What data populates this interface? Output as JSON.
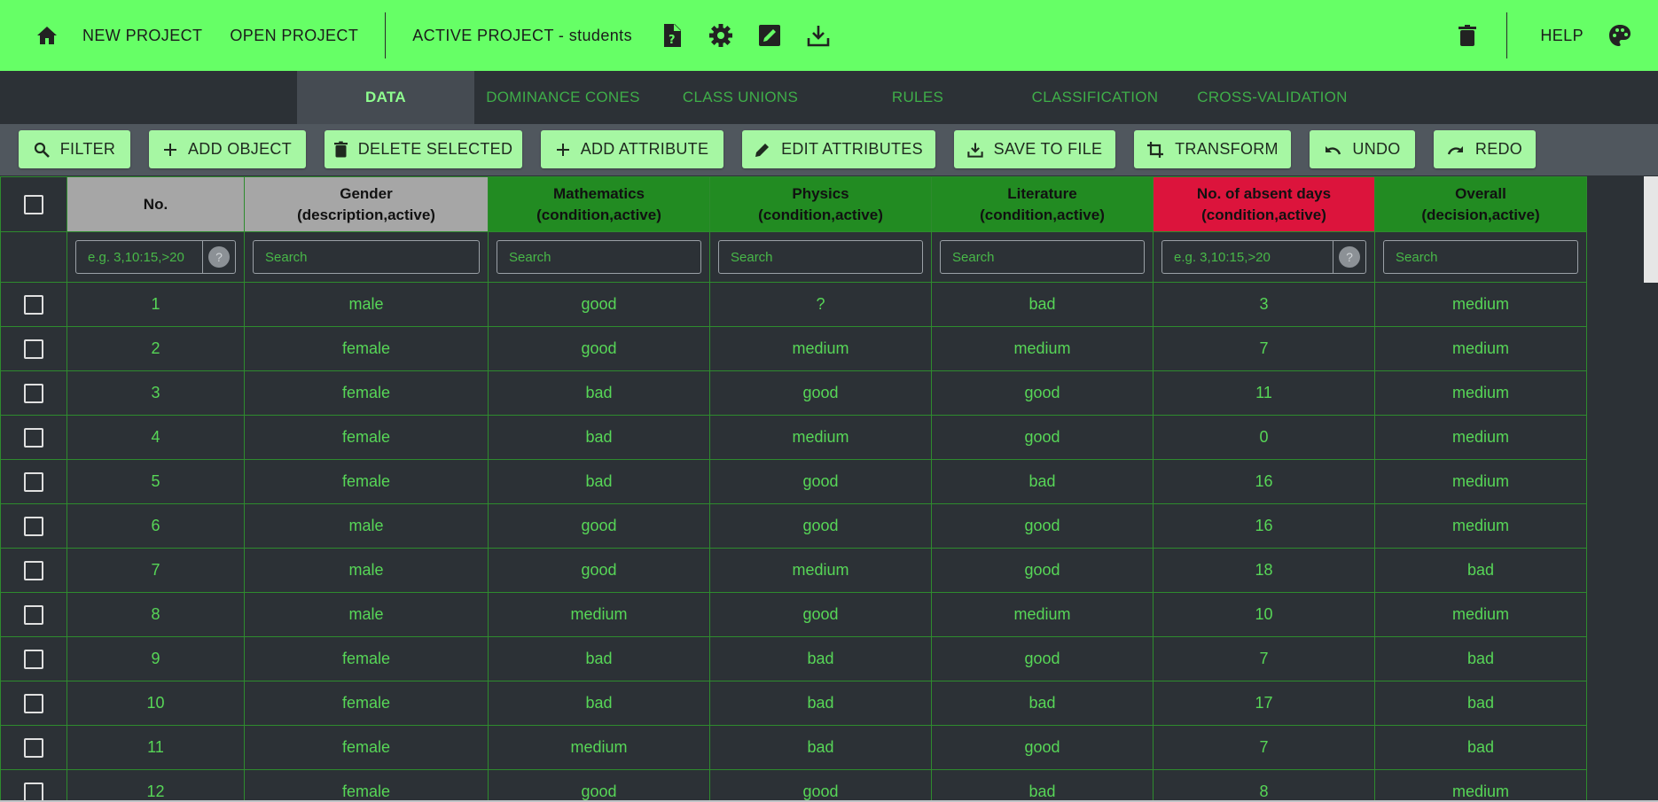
{
  "appbar": {
    "new_project": "NEW PROJECT",
    "open_project": "OPEN PROJECT",
    "active_project": "ACTIVE PROJECT - students",
    "help": "HELP"
  },
  "tabs": [
    {
      "label": "DATA",
      "active": true
    },
    {
      "label": "DOMINANCE CONES"
    },
    {
      "label": "CLASS UNIONS"
    },
    {
      "label": "RULES"
    },
    {
      "label": "CLASSIFICATION"
    },
    {
      "label": "CROSS-VALIDATION"
    }
  ],
  "toolbar": {
    "filter": "FILTER",
    "add_object": "ADD OBJECT",
    "delete_selected": "DELETE SELECTED",
    "add_attribute": "ADD ATTRIBUTE",
    "edit_attributes": "EDIT ATTRIBUTES",
    "save_to_file": "SAVE TO FILE",
    "transform": "TRANSFORM",
    "undo": "UNDO",
    "redo": "REDO"
  },
  "table": {
    "headers": [
      {
        "name": "No.",
        "sub": ""
      },
      {
        "name": "Gender",
        "sub": "(description,active)"
      },
      {
        "name": "Mathematics",
        "sub": "(condition,active)"
      },
      {
        "name": "Physics",
        "sub": "(condition,active)"
      },
      {
        "name": "Literature",
        "sub": "(condition,active)"
      },
      {
        "name": "No. of absent days",
        "sub": "(condition,active)"
      },
      {
        "name": "Overall",
        "sub": "(decision,active)"
      }
    ],
    "filters": {
      "no": "e.g. 3,10:15,>20",
      "gender": "Search",
      "mathematics": "Search",
      "physics": "Search",
      "literature": "Search",
      "absent": "e.g. 3,10:15,>20",
      "overall": "Search",
      "help": "?"
    },
    "rows": [
      [
        "1",
        "male",
        "good",
        "?",
        "bad",
        "3",
        "medium"
      ],
      [
        "2",
        "female",
        "good",
        "medium",
        "medium",
        "7",
        "medium"
      ],
      [
        "3",
        "female",
        "bad",
        "good",
        "good",
        "11",
        "medium"
      ],
      [
        "4",
        "female",
        "bad",
        "medium",
        "good",
        "0",
        "medium"
      ],
      [
        "5",
        "female",
        "bad",
        "good",
        "bad",
        "16",
        "medium"
      ],
      [
        "6",
        "male",
        "good",
        "good",
        "good",
        "16",
        "medium"
      ],
      [
        "7",
        "male",
        "good",
        "medium",
        "good",
        "18",
        "bad"
      ],
      [
        "8",
        "male",
        "medium",
        "good",
        "medium",
        "10",
        "medium"
      ],
      [
        "9",
        "female",
        "bad",
        "bad",
        "good",
        "7",
        "bad"
      ],
      [
        "10",
        "female",
        "bad",
        "bad",
        "bad",
        "17",
        "bad"
      ],
      [
        "11",
        "female",
        "medium",
        "bad",
        "good",
        "7",
        "bad"
      ],
      [
        "12",
        "female",
        "good",
        "good",
        "bad",
        "8",
        "medium"
      ]
    ]
  },
  "colors": {
    "appbar": "#66ff66",
    "description_header": "#a6a6a6",
    "condition_header": "#228b22",
    "cost_header": "#dc143c",
    "cell_text": "#57d657"
  }
}
